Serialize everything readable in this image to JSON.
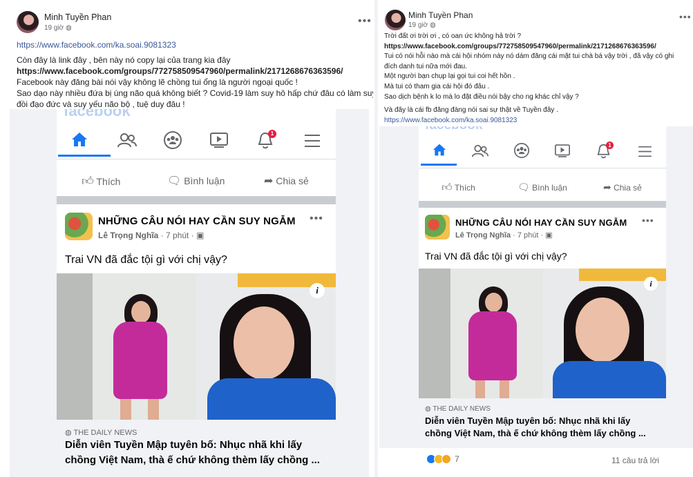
{
  "colors": {
    "link": "#385898",
    "accent": "#1877f2",
    "muted": "#65676b",
    "notif": "#e41e3f",
    "dress": "#c42b9a",
    "blue_top": "#1f62c9"
  },
  "left_post": {
    "author": "Minh Tuyền Phan",
    "time": "19 giờ",
    "privacy_icon": "globe-icon",
    "lines": [
      {
        "text": "https://www.facebook.com/ka.soai.9081323",
        "style": "link"
      },
      {
        "text": "Còn đây là link đây , bên này nó copy lại của trang kia đây",
        "style": "normal"
      },
      {
        "text": "https://www.facebook.com/groups/772758509547960/permalink/2171268676363596/",
        "style": "bold"
      },
      {
        "text": "Facebook này đăng bài nói vậy không lẽ chồng tui ổng là người ngoại quốc !",
        "style": "normal"
      },
      {
        "text": "Sao dạo này nhiều đứa bị úng não quá không biết ? Covid-19 làm suy hô hấp chứ đâu có làm suy",
        "style": "normal"
      },
      {
        "text": "đồi đạo đức và suy yếu não bộ , tuệ duy đâu !",
        "style": "normal"
      }
    ]
  },
  "right_post": {
    "author": "Minh Tuyền Phan",
    "time": "19 giờ",
    "privacy_icon": "globe-icon",
    "lines": [
      {
        "text": "Trời đất ơi trời ơi , có oan ức không hả trời ?",
        "style": "normal"
      },
      {
        "text": "https://www.facebook.com/groups/772758509547960/permalink/2171268676363596/",
        "style": "bold"
      },
      {
        "text": "Tui có nói hỗi nào mà cái hội nhóm này nó dám đăng cái mặt tui chà bá vậy trời , đã vậy có ghi",
        "style": "normal"
      },
      {
        "text": "đích danh tui nữa mới đau.",
        "style": "normal"
      },
      {
        "text": "Một người bạn chụp lại gọi tui coi hết hồn .",
        "style": "normal"
      },
      {
        "text": "Mà tui có tham gia cái hội đó đâu .",
        "style": "normal"
      },
      {
        "text": "Sao dịch bệnh k lo mà lo đặt điều nói bậy cho ng khác chỉ vậy ?",
        "style": "normal"
      },
      {
        "text": "Và đây là cái fb đăng đàng nói sai sự thật về Tuyền đây .",
        "style": "normal"
      },
      {
        "text": "https://www.facebook.com/ka.soai.9081323",
        "style": "link"
      }
    ],
    "reaction_count": "7",
    "reply_count": "11 câu trả lời"
  },
  "shot": {
    "ghost_text": "facebook",
    "notification_count": "1",
    "like_label": "Thích",
    "comment_label": "Bình luận",
    "share_label": "Chia sẻ",
    "page_name": "NHỮNG CÂU NÓI HAY CẦN SUY NGẪM",
    "poster": "Lê Trọng Nghĩa",
    "poster_time": "· 7 phút ·",
    "post_text": "Trai VN đã đắc tội gì với chị vậy?",
    "info_icon": "i",
    "source": "THE DAILY NEWS",
    "headline_1": "Diễn viên Tuyền Mập tuyên bố: Nhục nhã khi lấy",
    "headline_2": "chồng Việt Nam, thà ế chứ không thèm lấy chồng ..."
  }
}
